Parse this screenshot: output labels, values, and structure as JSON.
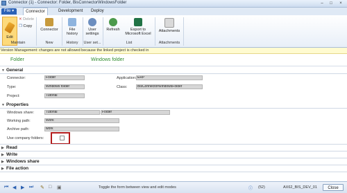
{
  "window": {
    "title": "Connector (1) - Connector: Folder, BisConnectorWindowsFolder"
  },
  "ribbon": {
    "file_label": "File",
    "tabs": [
      "Connector",
      "Development",
      "Deploy"
    ],
    "buttons": {
      "edit": "Edit",
      "delete": "Delete",
      "copy": "Copy",
      "connector": "Connector",
      "file_history": [
        "File",
        "history"
      ],
      "user_settings": [
        "User",
        "settings"
      ],
      "refresh": "Refresh",
      "export": [
        "Export to",
        "Microsoft Excel"
      ],
      "attachments": "Attachments"
    },
    "groups": [
      "Maintain",
      "New",
      "History",
      "User set...",
      "List",
      "Attachments"
    ]
  },
  "warning": "Version Management: changes are not allowed because the linked project is checked in",
  "header": {
    "left": "Folder",
    "right": "Windows folder"
  },
  "general": {
    "title": "General",
    "connector_label": "Connector:",
    "connector_value": "Folder",
    "type_label": "Type:",
    "type_value": "Windows folder",
    "project_label": "Project:",
    "project_value": "Tutorial",
    "application_label": "Application:",
    "application_value": "ERP",
    "class_label": "Class:",
    "class_value": "BisConnectorWindowsFolder"
  },
  "properties": {
    "title": "Properties",
    "share_label": "Windows share:",
    "share_value": "Tutorial",
    "share_value2": "Folder",
    "working_label": "Working path:",
    "working_value": "Work",
    "archive_label": "Archive path:",
    "archive_value": "work",
    "use_company_label": "Use company folders:"
  },
  "collapsed_sections": [
    "Read",
    "Write",
    "Windows share",
    "File action"
  ],
  "status": {
    "hint": "Toggle the form between view and edit modes",
    "count": "(52)",
    "env": "AX62_BIS_DEV_01",
    "close": "Close"
  },
  "colors": {
    "accent": "#2b62b7",
    "header_green": "#2e8b2e",
    "highlight": "#b31b1b",
    "warning_bg": "#fffbd0"
  }
}
